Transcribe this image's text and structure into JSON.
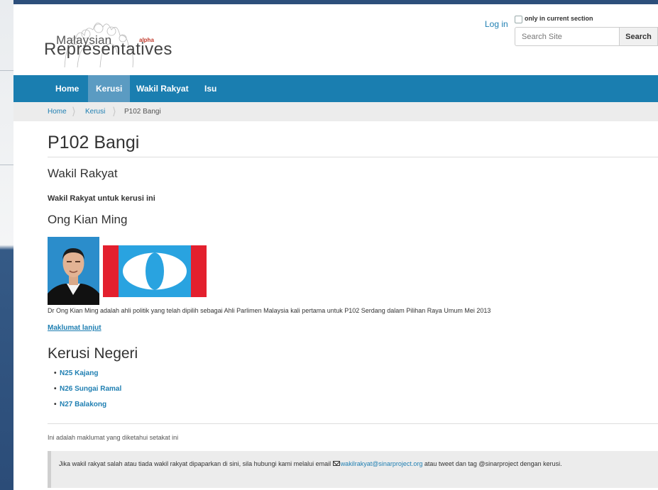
{
  "site": {
    "logo_line1": "Malaysian",
    "logo_line2": "Representatives",
    "logo_badge": "alpha"
  },
  "header": {
    "login_label": "Log in",
    "section_filter_label": "only in current section",
    "section_filter_checked": false,
    "search_placeholder": "Search Site",
    "search_button": "Search"
  },
  "nav": {
    "items": [
      {
        "label": "Home"
      },
      {
        "label": "Kerusi",
        "active": true
      },
      {
        "label": "Wakil Rakyat"
      },
      {
        "label": "Isu"
      }
    ]
  },
  "breadcrumb": {
    "items": [
      "Home",
      "Kerusi",
      "P102 Bangi"
    ]
  },
  "main": {
    "title": "P102 Bangi",
    "rep_heading": "Wakil Rakyat",
    "rep_subheading": "Wakil Rakyat untuk kerusi ini",
    "rep_name": "Ong Kian Ming",
    "rep_bio": "Dr Ong Kian Ming adalah ahli politik yang telah dipilih sebagai Ahli Parlimen Malaysia kali pertama untuk P102 Serdang dalam Pilihan Raya Umum Mei 2013",
    "more_link": "Maklumat lanjut",
    "state_heading": "Kerusi Negeri",
    "state_seats": [
      "N25 Kajang",
      "N26 Sungai Ramal",
      "N27 Balakong"
    ]
  },
  "footer": {
    "note": "Ini adalah maklumat yang diketahui setakat ini",
    "callout_prefix": "Jika wakil rakyat salah atau tiada wakil rakyat dipaparkan di sini, sila hubungi kami melalui email ",
    "callout_email": "wakilrakyat@sinarproject.org",
    "callout_suffix": " atau tweet dan tag @sinarproject dengan kerusi."
  },
  "colors": {
    "nav_bg": "#1a7eb0",
    "nav_active": "#5b9bc2",
    "link": "#1f7fb2",
    "flag_blue": "#29a3e0",
    "flag_red": "#e3202e"
  }
}
